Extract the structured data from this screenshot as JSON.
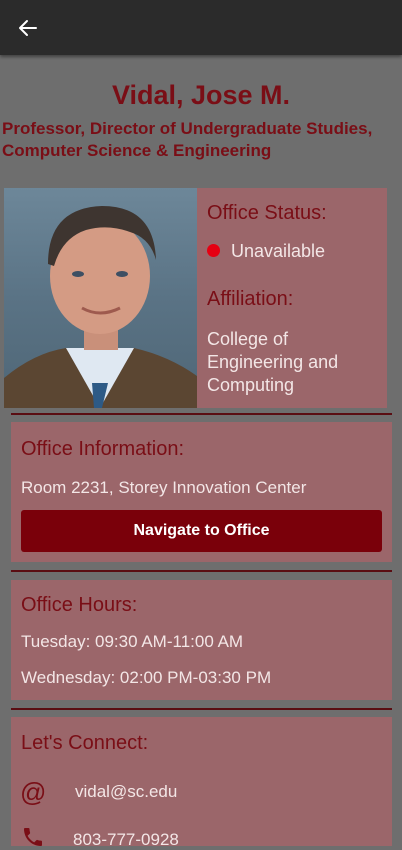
{
  "header": {
    "back_icon": "arrow-left-icon"
  },
  "profile": {
    "name": "Vidal, Jose M.",
    "title_line1": "Professor, Director of Undergraduate Studies,",
    "title_line2": "Computer Science & Engineering"
  },
  "status": {
    "heading": "Office Status:",
    "value": "Unavailable",
    "indicator_color": "#e60012",
    "affiliation_heading": "Affiliation:",
    "affiliation_line1": "College of",
    "affiliation_line2": "Engineering and",
    "affiliation_line3": "Computing"
  },
  "office": {
    "heading": "Office Information:",
    "location": "Room 2231, Storey Innovation Center",
    "navigate_label": "Navigate to Office"
  },
  "hours": {
    "heading": "Office Hours:",
    "line1": "Tuesday: 09:30 AM-11:00 AM",
    "line2": "Wednesday: 02:00 PM-03:30 PM"
  },
  "connect": {
    "heading": "Let's Connect:",
    "email": "vidal@sc.edu",
    "phone": "803-777-0928"
  },
  "colors": {
    "accent": "#7a0e16",
    "card": "#9b666a",
    "button": "#7a000a",
    "background": "#6e6e6e",
    "topbar": "#2b2b2b"
  }
}
